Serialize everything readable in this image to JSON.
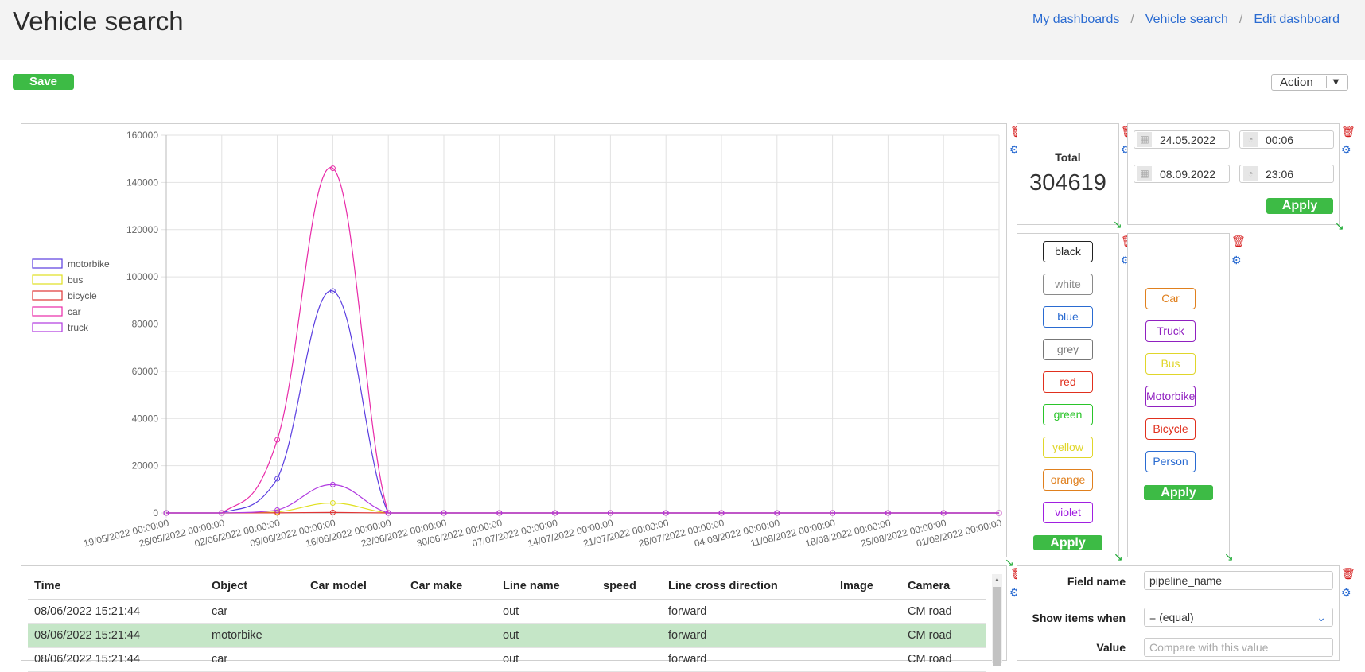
{
  "header": {
    "title": "Vehicle search",
    "breadcrumbs": [
      "My dashboards",
      "Vehicle search",
      "Edit dashboard"
    ]
  },
  "toolbar": {
    "save_label": "Save",
    "action_label": "Action"
  },
  "colors": {
    "accent_green": "#3dbb45",
    "link_blue": "#2a6bd1",
    "delete_red": "#d51a1a",
    "selected_row": "#c5e6c7"
  },
  "icons": {
    "delete": "trash-icon",
    "settings": "gears-icon",
    "resize": "resize-arrow-icon",
    "calendar": "calendar-icon",
    "clock": "clock-icon"
  },
  "chart_data": {
    "type": "line",
    "x": [
      "19/05/2022 00:00:00",
      "26/05/2022 00:00:00",
      "02/06/2022 00:00:00",
      "09/06/2022 00:00:00",
      "16/06/2022 00:00:00",
      "23/06/2022 00:00:00",
      "30/06/2022 00:00:00",
      "07/07/2022 00:00:00",
      "14/07/2022 00:00:00",
      "21/07/2022 00:00:00",
      "28/07/2022 00:00:00",
      "04/08/2022 00:00:00",
      "11/08/2022 00:00:00",
      "18/08/2022 00:00:00",
      "25/08/2022 00:00:00",
      "01/09/2022 00:00:00"
    ],
    "yticks": [
      "0",
      "20000",
      "40000",
      "60000",
      "80000",
      "100000",
      "120000",
      "140000",
      "160000"
    ],
    "ylim": [
      0,
      160000
    ],
    "legend_position": "left",
    "grid": true,
    "series": [
      {
        "name": "motorbike",
        "color": "#5a3de0",
        "values": [
          0,
          0,
          14500,
          94000,
          0,
          0,
          0,
          0,
          0,
          0,
          0,
          0,
          0,
          0,
          0,
          0
        ]
      },
      {
        "name": "bus",
        "color": "#e0e020",
        "values": [
          0,
          0,
          400,
          4200,
          0,
          0,
          0,
          0,
          0,
          0,
          0,
          0,
          0,
          0,
          0,
          0
        ]
      },
      {
        "name": "bicycle",
        "color": "#e03535",
        "values": [
          0,
          0,
          50,
          200,
          0,
          0,
          0,
          0,
          0,
          0,
          0,
          0,
          0,
          0,
          0,
          0
        ]
      },
      {
        "name": "car",
        "color": "#e82aa8",
        "values": [
          0,
          0,
          31000,
          146000,
          0,
          0,
          0,
          0,
          0,
          0,
          0,
          0,
          0,
          0,
          0,
          0
        ]
      },
      {
        "name": "truck",
        "color": "#b03ae0",
        "values": [
          0,
          0,
          1200,
          12000,
          0,
          0,
          0,
          0,
          0,
          0,
          0,
          0,
          0,
          0,
          0,
          0
        ]
      }
    ]
  },
  "total": {
    "label": "Total",
    "value": "304619"
  },
  "date_range": {
    "start_date": "24.05.2022",
    "start_time": "00:06",
    "end_date": "08.09.2022",
    "end_time": "23:06",
    "apply_label": "Apply"
  },
  "color_filter": {
    "apply_label": "Apply",
    "chips": [
      {
        "label": "black",
        "color": "#222222"
      },
      {
        "label": "white",
        "color": "#8a8a8a"
      },
      {
        "label": "blue",
        "color": "#2a6bd1"
      },
      {
        "label": "grey",
        "color": "#777777"
      },
      {
        "label": "red",
        "color": "#e0301e"
      },
      {
        "label": "green",
        "color": "#2ac42a"
      },
      {
        "label": "yellow",
        "color": "#e0d62a"
      },
      {
        "label": "orange",
        "color": "#e0801e"
      },
      {
        "label": "violet",
        "color": "#a020e0"
      }
    ]
  },
  "type_filter": {
    "apply_label": "Apply",
    "chips": [
      {
        "label": "Car",
        "color": "#e0801e"
      },
      {
        "label": "Truck",
        "color": "#9020c0"
      },
      {
        "label": "Bus",
        "color": "#e0d62a"
      },
      {
        "label": "Motorbike",
        "color": "#9020c0"
      },
      {
        "label": "Bicycle",
        "color": "#e0301e"
      },
      {
        "label": "Person",
        "color": "#2a6bd1"
      }
    ]
  },
  "table": {
    "columns": [
      "Time",
      "Object",
      "Car model",
      "Car make",
      "Line name",
      "speed",
      "Line cross direction",
      "Image",
      "Camera"
    ],
    "rows": [
      [
        "08/06/2022 15:21:44",
        "car",
        "",
        "",
        "out",
        "",
        "forward",
        "",
        "CM road"
      ],
      [
        "08/06/2022 15:21:44",
        "motorbike",
        "",
        "",
        "out",
        "",
        "forward",
        "",
        "CM road"
      ],
      [
        "08/06/2022 15:21:44",
        "car",
        "",
        "",
        "out",
        "",
        "forward",
        "",
        "CM road"
      ]
    ],
    "selected_row": 1
  },
  "field_filter": {
    "field_name_label": "Field name",
    "field_name_value": "pipeline_name",
    "show_items_label": "Show items when",
    "show_items_value": "= (equal)",
    "value_label": "Value",
    "value_placeholder": "Compare with this value"
  }
}
